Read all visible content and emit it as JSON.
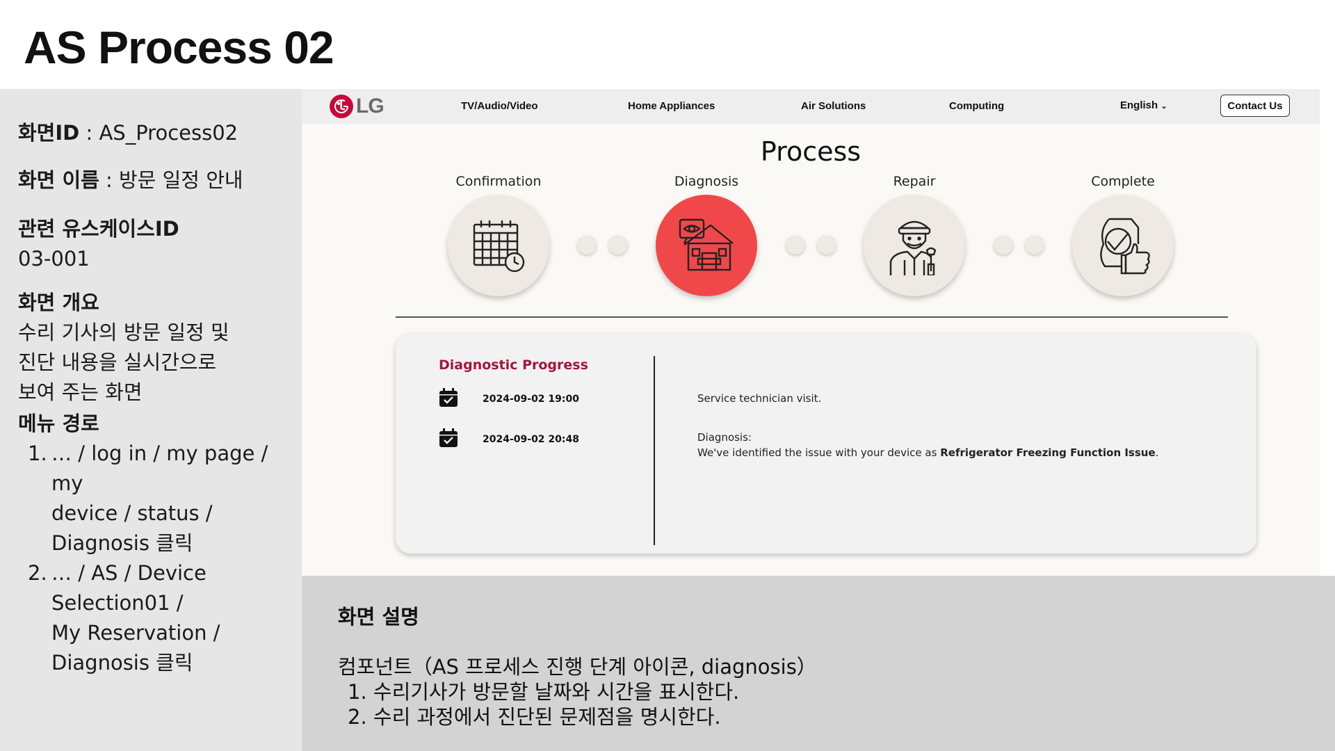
{
  "slide_title": "AS Process 02",
  "spec": {
    "screen_id_label": "화면ID",
    "screen_id_value": " : AS_Process02",
    "screen_name_label": "화면 이름",
    "screen_name_value": " : 방문 일정 안내",
    "usecase_label": "관련 유스케이스ID",
    "usecase_value": "03-001",
    "overview_label": "화면 개요",
    "overview_lines": [
      "수리 기사의 방문 일정 및",
      "진단 내용을 실시간으로",
      "보여 주는 화면"
    ],
    "menu_label": "메뉴 경로",
    "menu_items": [
      {
        "num": "1.",
        "lines": [
          "… / log in / my page / my",
          "device / status /",
          "Diagnosis 클릭"
        ]
      },
      {
        "num": "2.",
        "lines": [
          "… / AS / Device",
          "Selection01 /",
          "My Reservation /",
          "Diagnosis 클릭"
        ]
      }
    ]
  },
  "nav": {
    "logo_text": "LG",
    "items": [
      "TV/Audio/Video",
      "Home Appliances",
      "Air Solutions",
      "Computing"
    ],
    "language": "English",
    "contact": "Contact Us"
  },
  "process": {
    "title": "Process",
    "steps": [
      {
        "label": "Confirmation",
        "icon": "calendar-clock-icon",
        "active": false
      },
      {
        "label": "Diagnosis",
        "icon": "house-inspection-icon",
        "active": true
      },
      {
        "label": "Repair",
        "icon": "technician-icon",
        "active": false
      },
      {
        "label": "Complete",
        "icon": "document-thumbs-up-icon",
        "active": false
      }
    ],
    "active_color": "#f0484a",
    "inactive_color": "#eeeae3"
  },
  "card": {
    "title": "Diagnostic Progress",
    "entries": [
      {
        "datetime": "2024-09-02 19:00",
        "text": "Service technician visit.",
        "heading": "",
        "text_prefix": "",
        "text_bold": "",
        "text_suffix": ""
      },
      {
        "datetime": "2024-09-02 20:48",
        "heading": "Diagnosis:",
        "text_prefix": "We've identified the issue with your device as ",
        "text_bold": "Refrigerator Freezing Function Issue",
        "text_suffix": "."
      }
    ]
  },
  "note": {
    "heading": "화면 설명",
    "component": "컴포넌트（AS 프로세스 진행 단계 아이콘, diagnosis）",
    "items": [
      "1. 수리기사가 방문할 날짜와 시간을 표시한다.",
      "2. 수리 과정에서 진단된 문제점을 명시한다."
    ]
  },
  "colors": {
    "brand": "#c6093b",
    "accent_title": "#a0173b"
  }
}
